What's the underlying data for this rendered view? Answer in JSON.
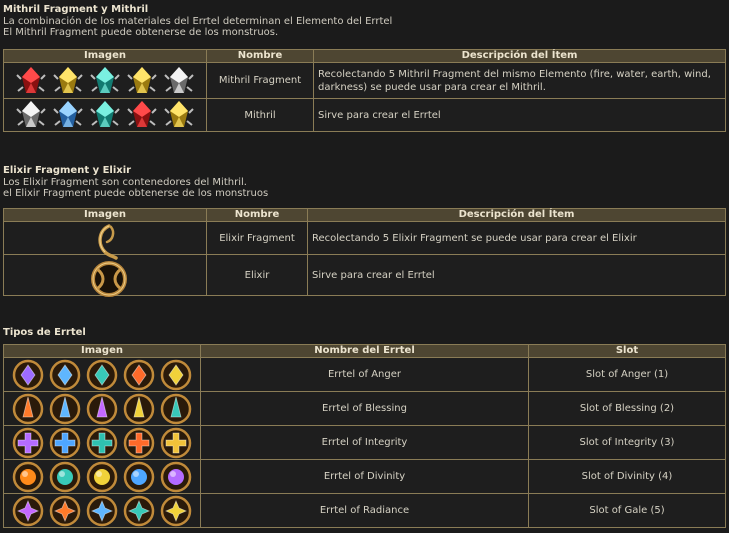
{
  "sec1": {
    "title": "Mithril Fragment y Mithril",
    "line1": "La combinación de los materiales del Errtel determinan el Elemento del Errtel",
    "line2": "El Mithril Fragment puede obtenerse de los monstruos.",
    "headers": [
      "Imagen",
      "Nombre",
      "Descripción del Ítem"
    ],
    "rows": [
      {
        "name": "Mithril Fragment",
        "desc": "Recolectando 5 Mithril Fragment del mismo Elemento (fire, water, earth, wind, darkness) se puede usar para crear el Mithril.",
        "icons": [
          "red",
          "yellow",
          "teal",
          "yellow",
          "grey"
        ]
      },
      {
        "name": "Mithril",
        "desc": "Sirve para crear el Errtel",
        "icons": [
          "grey",
          "blue",
          "teal",
          "red",
          "yellow"
        ]
      }
    ]
  },
  "sec2": {
    "title": "Elixir Fragment y Elixir",
    "line1": "Los Elixir Fragment son contenedores del Mithril.",
    "line2": "el Elixir Fragment puede obtenerse de los monstruos",
    "headers": [
      "Imagen",
      "Nombre",
      "Descripción del Ítem"
    ],
    "rows": [
      {
        "name": "Elixir Fragment",
        "desc": "Recolectando 5 Elixir Fragment se puede usar para crear el Elixir",
        "icon": "elixir-fragment-icon"
      },
      {
        "name": "Elixir",
        "desc": "Sirve para crear el Errtel",
        "icon": "elixir-icon"
      }
    ]
  },
  "sec3": {
    "title": "Tipos de Errtel",
    "headers": [
      "Imagen",
      "Nombre del Errtel",
      "Slot"
    ],
    "rows": [
      {
        "name": "Errtel of Anger",
        "slot": "Slot of Anger (1)",
        "shape": "diamond",
        "icons": [
          "#9d6bff",
          "#5fb6ff",
          "#38c9b8",
          "#ff6a2a",
          "#f1d23a"
        ]
      },
      {
        "name": "Errtel of Blessing",
        "slot": "Slot of Blessing (2)",
        "shape": "spike",
        "icons": [
          "#ff7a2a",
          "#5fb6ff",
          "#c468ff",
          "#f1d23a",
          "#38c9b8"
        ]
      },
      {
        "name": "Errtel of Integrity",
        "slot": "Slot of Integrity (3)",
        "shape": "cross",
        "icons": [
          "#b46bff",
          "#4ea6ff",
          "#2fc0b0",
          "#ff6a2a",
          "#f1c23a"
        ]
      },
      {
        "name": "Errtel of Divinity",
        "slot": "Slot of Divinity (4)",
        "shape": "orb",
        "icons": [
          "#ff8a1a",
          "#38c9b8",
          "#f1d23a",
          "#4ea6ff",
          "#b46bff"
        ]
      },
      {
        "name": "Errtel of Radiance",
        "slot": "Slot of Gale (5)",
        "shape": "star",
        "icons": [
          "#c468ff",
          "#ff7a2a",
          "#5fb6ff",
          "#38c9b8",
          "#f1d23a"
        ]
      }
    ]
  }
}
